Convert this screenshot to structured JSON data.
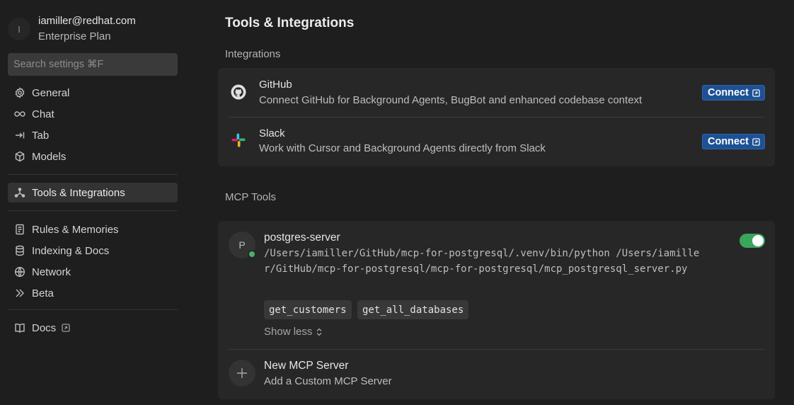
{
  "account": {
    "avatar_initial": "I",
    "email": "iamiller@redhat.com",
    "plan": "Enterprise Plan"
  },
  "search": {
    "placeholder": "Search settings ⌘F"
  },
  "sidebar": {
    "items": [
      {
        "label": "General",
        "icon": "gear-icon"
      },
      {
        "label": "Chat",
        "icon": "infinity-icon"
      },
      {
        "label": "Tab",
        "icon": "arrow-right-bar-icon"
      },
      {
        "label": "Models",
        "icon": "cube-icon"
      },
      {
        "label": "Tools & Integrations",
        "icon": "nodes-icon",
        "active": true
      },
      {
        "label": "Rules & Memories",
        "icon": "document-icon"
      },
      {
        "label": "Indexing & Docs",
        "icon": "database-icon"
      },
      {
        "label": "Network",
        "icon": "globe-icon"
      },
      {
        "label": "Beta",
        "icon": "double-chevron-icon"
      },
      {
        "label": "Docs",
        "icon": "book-icon",
        "external_icon": "external-link-icon"
      }
    ]
  },
  "main": {
    "title": "Tools & Integrations",
    "integrations_label": "Integrations",
    "integrations": [
      {
        "name": "GitHub",
        "description": "Connect GitHub for Background Agents, BugBot and enhanced codebase context",
        "button": "Connect",
        "icon": "github-icon"
      },
      {
        "name": "Slack",
        "description": "Work with Cursor and Background Agents directly from Slack",
        "button": "Connect",
        "icon": "slack-icon"
      }
    ],
    "mcp_label": "MCP Tools",
    "mcp_server": {
      "avatar_initial": "P",
      "name": "postgres-server",
      "command": "/Users/iamiller/GitHub/mcp-for-postgresql/.venv/bin/python /Users/iamiller/GitHub/mcp-for-postgresql/mcp-for-postgresql/mcp_postgresql_server.py",
      "enabled": true,
      "status": "running",
      "tools": [
        "get_customers",
        "get_all_databases"
      ],
      "show_less": "Show less"
    },
    "new_mcp": {
      "name": "New MCP Server",
      "description": "Add a Custom MCP Server"
    }
  },
  "colors": {
    "background": "#1e1e1e",
    "card": "#272727",
    "connect_button": "#1d5194",
    "toggle_on": "#3ba55c",
    "status_dot": "#4caf6a"
  }
}
